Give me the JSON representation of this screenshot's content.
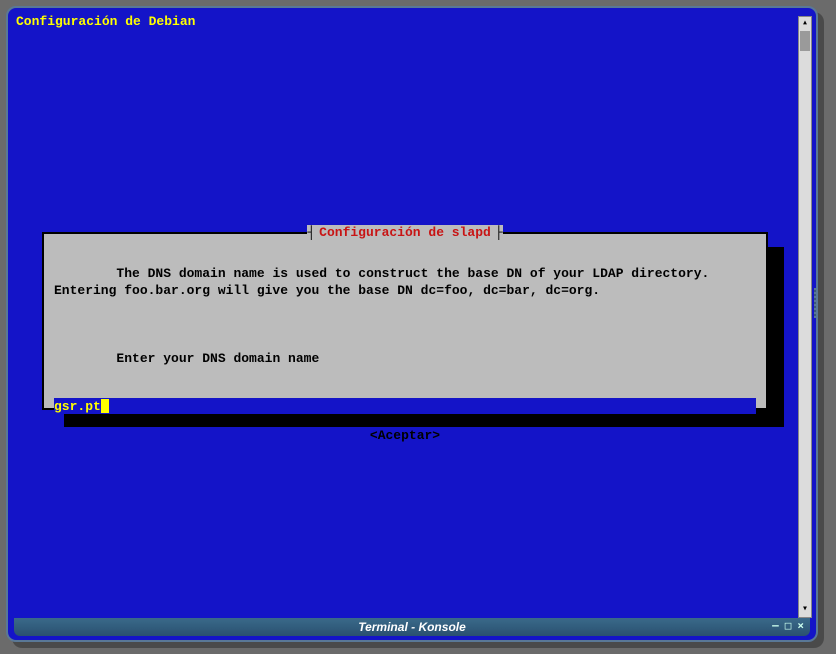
{
  "header": {
    "title": "Configuración de Debian"
  },
  "dialog": {
    "title": "Configuración de slapd",
    "body_line1": "The DNS domain name is used to construct the base DN of your LDAP directory. Entering foo.bar.org will give you the base DN dc=foo, dc=bar, dc=org.",
    "body_prompt": "Enter your DNS domain name",
    "input_value": "gsr.pt",
    "accept_label": "<Aceptar>"
  },
  "window": {
    "title": "Terminal - Konsole",
    "min": "—",
    "max": "□",
    "close": "×"
  }
}
